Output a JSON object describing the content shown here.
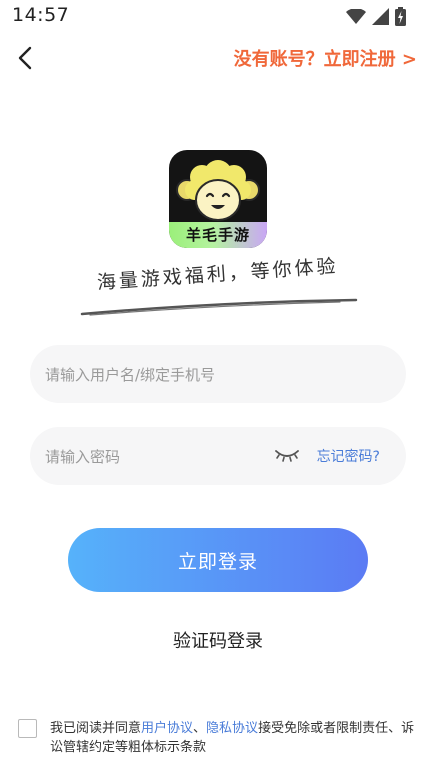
{
  "status_bar": {
    "time": "14:57",
    "icons": [
      "wifi-icon",
      "cellular-signal-icon",
      "battery-charging-icon"
    ]
  },
  "header": {
    "back_icon": "chevron-left-icon",
    "register_link": "没有账号？立即注册 >"
  },
  "logo": {
    "brand_text": "羊毛手游",
    "band_colors": [
      "#9bf07a",
      "#c9a6f5"
    ]
  },
  "slogan": "海量游戏福利，等你体验",
  "form": {
    "username_placeholder": "请输入用户名/绑定手机号",
    "password_placeholder": "请输入密码",
    "eye_icon": "eye-closed-icon",
    "forgot_password": "忘记密码?",
    "login_button": "立即登录",
    "sms_login": "验证码登录"
  },
  "agreement": {
    "prefix": "我已阅读并同意",
    "user_agreement": "用户协议",
    "separator": "、",
    "privacy_agreement": "隐私协议",
    "suffix": "接受免除或者限制责任、诉讼管辖约定等粗体标示条款"
  },
  "colors": {
    "accent_orange": "#f0683a",
    "link_blue": "#4a7cd8",
    "button_gradient": [
      "#56b2fa",
      "#5b7bf4"
    ],
    "input_bg": "#f6f6f7"
  }
}
